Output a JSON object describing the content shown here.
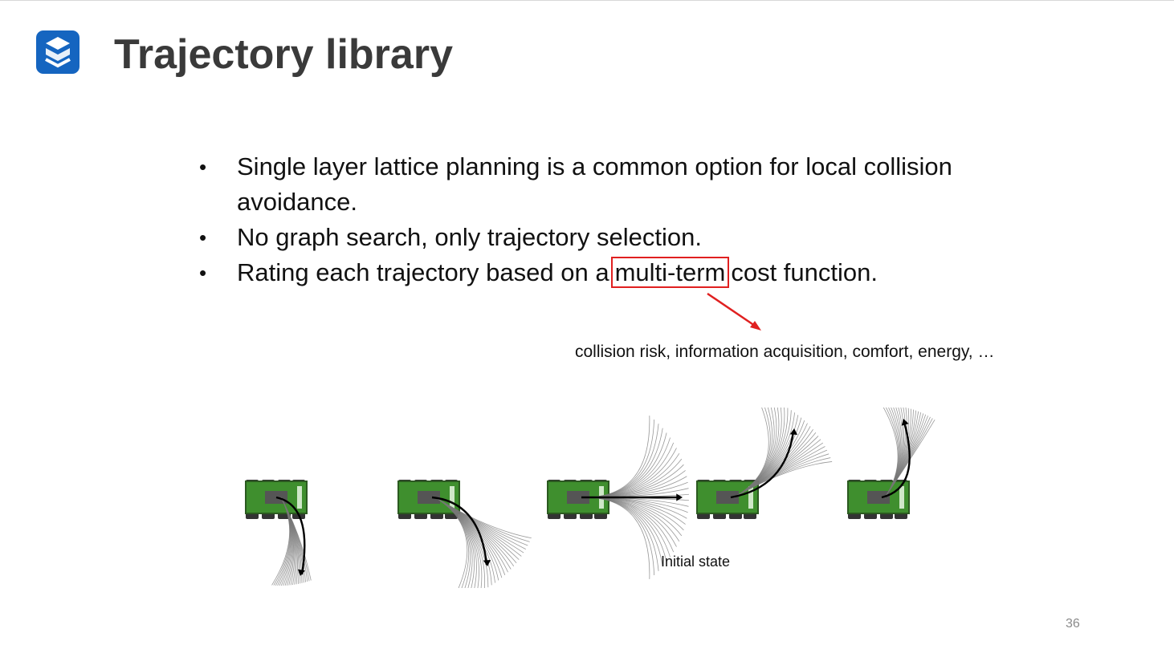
{
  "slide": {
    "title": "Trajectory library",
    "bullets": [
      {
        "text": "Single layer lattice planning is a common option for local collision avoidance."
      },
      {
        "text": "No graph search, only trajectory selection."
      },
      {
        "before": "Rating each trajectory based on a",
        "highlight": "multi-term",
        "after": "cost function."
      }
    ],
    "annotation": "collision risk, information acquisition, comfort, energy, …",
    "figure_caption": "Initial state",
    "page_number": "36"
  },
  "icons": {
    "logo": "brand-logo-icon",
    "bullet": "•"
  },
  "colors": {
    "logo_blue": "#1565c0",
    "highlight_red": "#e02020",
    "title_gray": "#3a3a3a",
    "robot_green": "#3f8f2e"
  }
}
